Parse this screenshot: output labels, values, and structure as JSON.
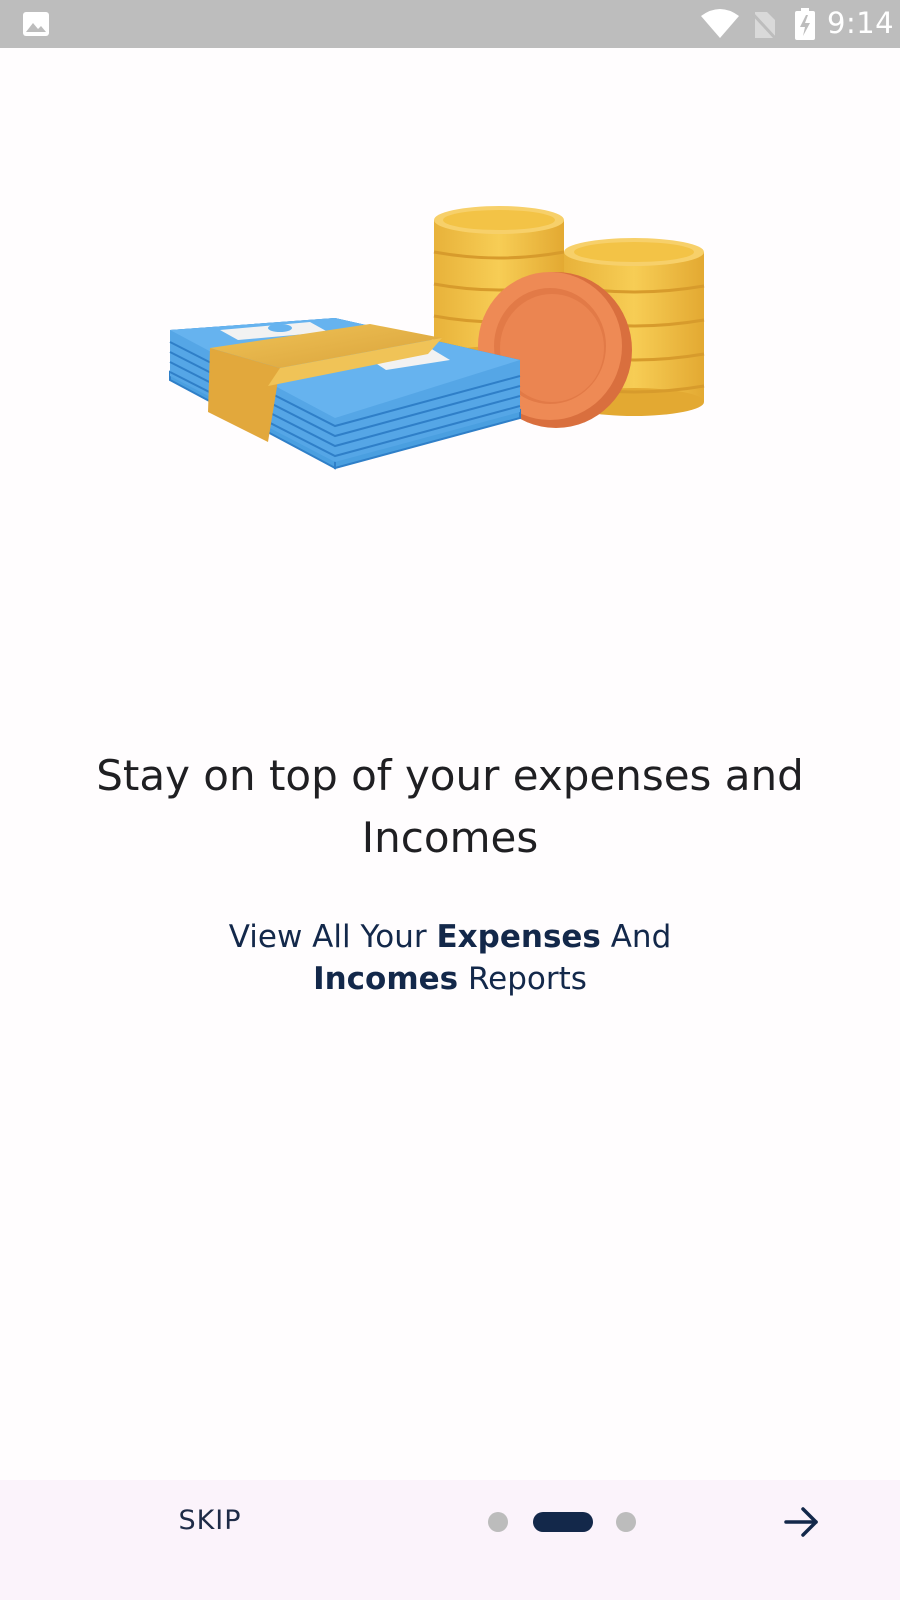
{
  "status_bar": {
    "time": "9:14",
    "icons": [
      "gallery-icon",
      "wifi-icon",
      "no-sim-icon",
      "battery-charging-icon"
    ]
  },
  "illustration": {
    "name": "money-stack-and-coins"
  },
  "onboarding": {
    "headline": "Stay on top of your expenses and Incomes",
    "subtitle": {
      "part1": "View All Your ",
      "bold1": "Expenses",
      "part2": " And",
      "bold2": "Incomes",
      "part3": " Reports"
    }
  },
  "footer": {
    "skip_label": "SKIP",
    "page_indicator": {
      "total": 3,
      "current": 2
    },
    "next_icon": "arrow-right-icon"
  },
  "colors": {
    "status_bar": "#bdbdbd",
    "background": "#fffdfe",
    "bottom_bar": "#fbf3fb",
    "accent_navy": "#13284a",
    "dot_inactive": "#bcbcbc",
    "bill_blue": "#4a9fe0",
    "band_yellow": "#e9b53e",
    "coin_gold": "#f3c346",
    "coin_orange": "#e9824f"
  }
}
